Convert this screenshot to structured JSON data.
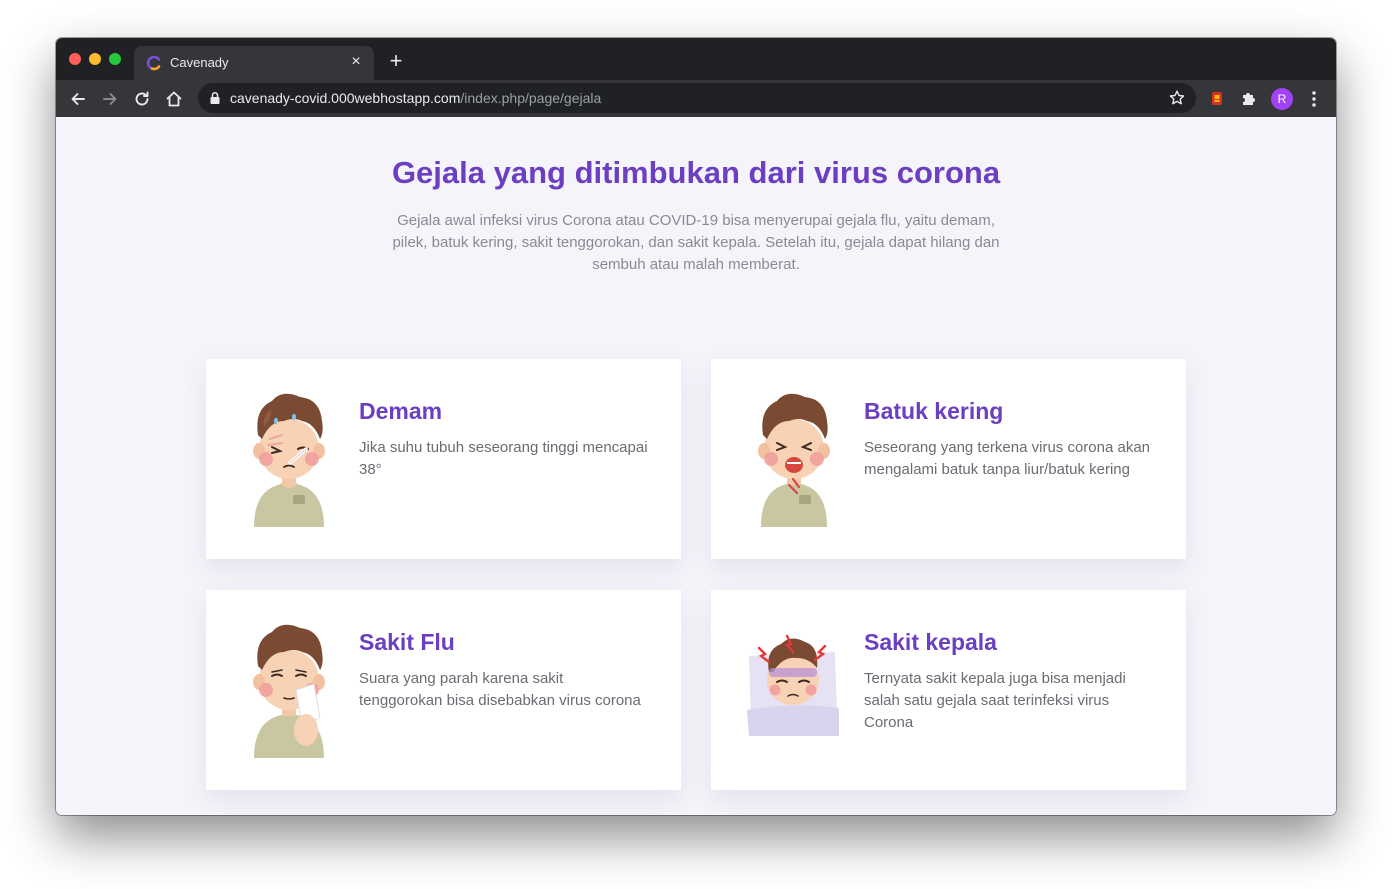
{
  "browser": {
    "tab_title": "Cavenady",
    "tab_close": "×",
    "new_tab": "+",
    "url_host": "cavenady-covid.000webhostapp.com",
    "url_path": "/index.php/page/gejala",
    "profile_initial": "R"
  },
  "page": {
    "heading": "Gejala yang ditimbukan dari virus corona",
    "subtext": "Gejala awal infeksi virus Corona atau COVID-19 bisa menyerupai gejala flu, yaitu demam, pilek, batuk kering, sakit tenggorokan, dan sakit kepala. Setelah itu, gejala dapat hilang dan sembuh atau malah memberat."
  },
  "cards": [
    {
      "title": "Demam",
      "desc": "Jika suhu tubuh seseorang tinggi mencapai 38°",
      "icon": "fever-illustration"
    },
    {
      "title": "Batuk kering",
      "desc": "Seseorang yang terkena virus corona akan mengalami batuk tanpa liur/batuk kering",
      "icon": "cough-illustration"
    },
    {
      "title": "Sakit Flu",
      "desc": "Suara yang parah karena sakit tenggorokan bisa disebabkan virus corona",
      "icon": "flu-illustration"
    },
    {
      "title": "Sakit kepala",
      "desc": "Ternyata sakit kepala juga bisa menjadi salah satu gejala saat terinfeksi virus Corona",
      "icon": "headache-illustration"
    }
  ],
  "colors": {
    "accent": "#6c3ec1",
    "page_bg": "#f5f4fa",
    "card_bg": "#ffffff",
    "body_text": "#6b6b74",
    "sub_text": "#8a8a94"
  }
}
